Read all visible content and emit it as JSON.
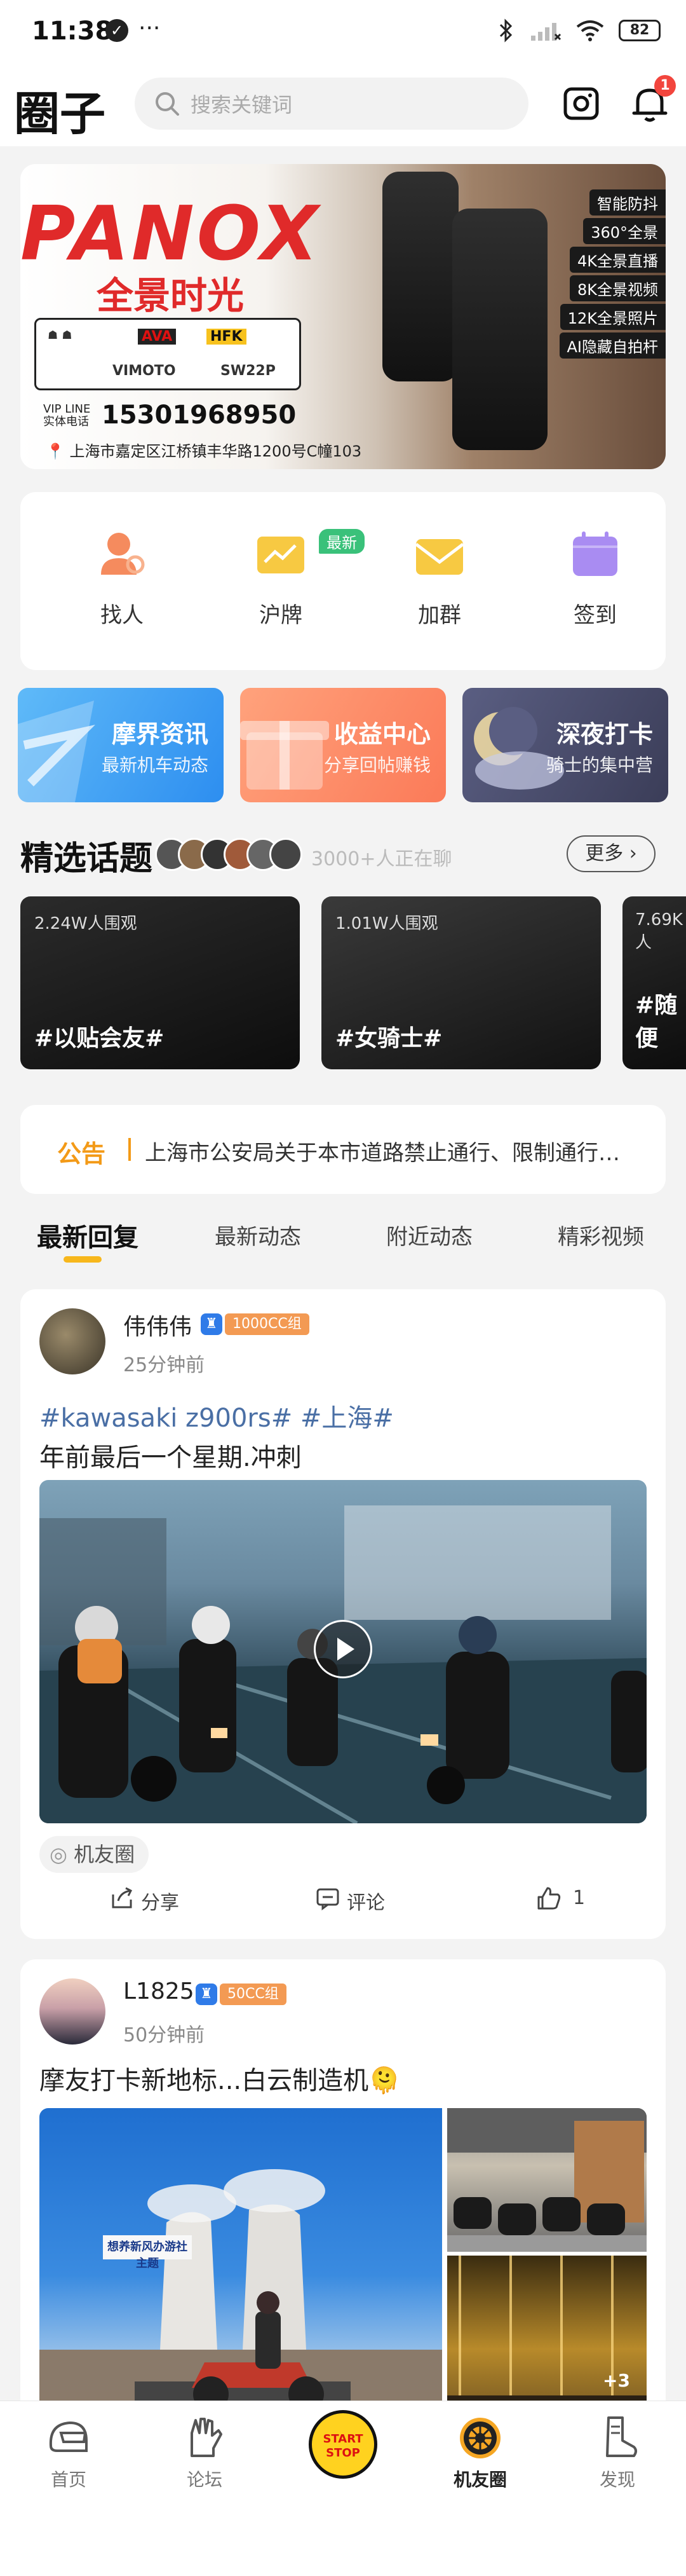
{
  "status_bar": {
    "time": "11:38",
    "dots": "···",
    "battery": "82"
  },
  "header": {
    "title": "圈子",
    "search_placeholder": "搜索关键词",
    "notification_count": "1"
  },
  "banner": {
    "brand": "PANOX",
    "slogan": "全景时光",
    "logos": [
      "AVA",
      "HFK",
      "VIMOTO",
      "SW22P"
    ],
    "vip_label": "VIP LINE\n实体电话",
    "phone": "15301968950",
    "address": "上海市嘉定区江桥镇丰华路1200号C幢103",
    "features": [
      "智能防抖",
      "360°全景",
      "4K全景直播",
      "8K全景视频",
      "12K全景照片",
      "AI隐藏自拍杆"
    ]
  },
  "quick_actions": [
    {
      "label": "找人",
      "icon": "find-people-icon",
      "color": "#f58b5e"
    },
    {
      "label": "沪牌",
      "icon": "license-plate-icon",
      "color": "#f7c942",
      "tag": "最新"
    },
    {
      "label": "加群",
      "icon": "join-group-icon",
      "color": "#f7c942"
    },
    {
      "label": "签到",
      "icon": "check-in-icon",
      "color": "#a98cf2"
    }
  ],
  "feature_cards": [
    {
      "title": "摩界资讯",
      "subtitle": "最新机车动态",
      "color": "#3ea2f5"
    },
    {
      "title": "收益中心",
      "subtitle": "分享回帖赚钱",
      "color": "#fc8a64"
    },
    {
      "title": "深夜打卡",
      "subtitle": "骑士的集中营",
      "color": "#4b4e70"
    }
  ],
  "topics": {
    "title": "精选话题",
    "online_count": "3000+人正在聊",
    "more_label": "更多",
    "cards": [
      {
        "views": "2.24W人围观",
        "name": "#以贴会友#"
      },
      {
        "views": "1.01W人围观",
        "name": "#女骑士#"
      },
      {
        "views": "7.69K人",
        "name": "#随便"
      }
    ]
  },
  "notice": {
    "tag": "公告",
    "text": "上海市公安局关于本市道路禁止通行、限制通行措..."
  },
  "tabs": [
    "最新回复",
    "最新动态",
    "附近动态",
    "精彩视频"
  ],
  "posts": [
    {
      "username": "伟伟伟",
      "level": "1000CC组",
      "time": "25分钟前",
      "tags": "#kawasaki z900rs# #上海#",
      "body": "年前最后一个星期.冲刺",
      "circle": "机友圈",
      "share_label": "分享",
      "comment_label": "评论",
      "like_count": "1"
    },
    {
      "username": "L1825",
      "level": "50CC组",
      "time": "50分钟前",
      "body": "摩友打卡新地标...白云制造机🫠",
      "sign_text": "想养新风办游社主题",
      "extra_count": "+3"
    }
  ],
  "bottom_nav": [
    {
      "label": "首页",
      "icon": "helmet-icon"
    },
    {
      "label": "论坛",
      "icon": "glove-icon"
    },
    {
      "label": "START\nSTOP",
      "icon": "start-stop-icon"
    },
    {
      "label": "机友圈",
      "icon": "wheel-icon"
    },
    {
      "label": "发现",
      "icon": "boot-icon"
    }
  ]
}
